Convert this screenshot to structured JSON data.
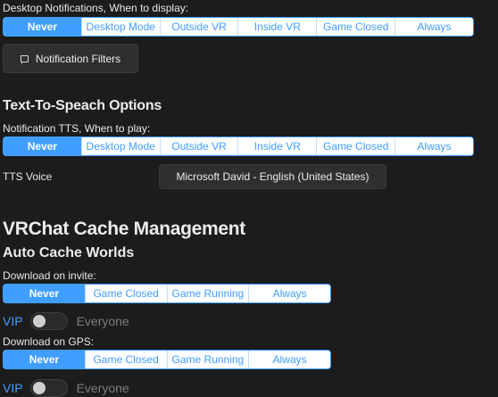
{
  "desktop_notifications": {
    "label": "Desktop Notifications, When to display:",
    "options": [
      "Never",
      "Desktop Mode",
      "Outside VR",
      "Inside VR",
      "Game Closed",
      "Always"
    ],
    "selected": "Never",
    "filters_button": "Notification Filters",
    "filters_icon": "chat-bubble-icon"
  },
  "tts": {
    "title": "Text-To-Speach Options",
    "label": "Notification TTS, When to play:",
    "options": [
      "Never",
      "Desktop Mode",
      "Outside VR",
      "Inside VR",
      "Game Closed",
      "Always"
    ],
    "selected": "Never",
    "voice_label": "TTS Voice",
    "voice_value": "Microsoft David - English (United States)"
  },
  "cache": {
    "title": "VRChat Cache Management",
    "subtitle": "Auto Cache Worlds",
    "invite": {
      "label": "Download on invite:",
      "options": [
        "Never",
        "Game Closed",
        "Game Running",
        "Always"
      ],
      "selected": "Never",
      "toggle_left": "VIP",
      "toggle_right": "Everyone",
      "toggle_on": false
    },
    "gps": {
      "label": "Download on GPS:",
      "options": [
        "Never",
        "Game Closed",
        "Game Running",
        "Always"
      ],
      "selected": "Never",
      "toggle_left": "VIP",
      "toggle_right": "Everyone",
      "toggle_on": false
    }
  },
  "colors": {
    "accent": "#409eff",
    "background": "#1c1c1c",
    "text": "#e8e8e8",
    "muted": "#7d7d7d"
  }
}
